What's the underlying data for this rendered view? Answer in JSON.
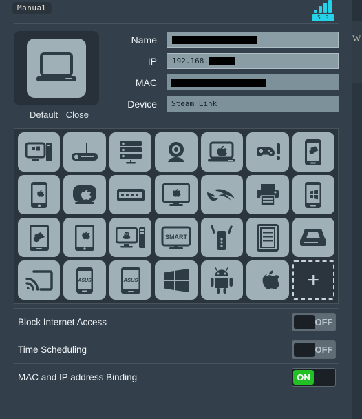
{
  "header": {
    "mode_badge": "Manual",
    "signal": {
      "icon": "signal-bars-icon",
      "bars": 4,
      "band_label": "5 G",
      "color": "#25d2e8"
    }
  },
  "detail": {
    "thumbnail_icon": "laptop-icon",
    "default_link": "Default",
    "close_link": "Close",
    "fields": [
      {
        "label": "Name",
        "value": "",
        "redacted": true,
        "editable": true,
        "redact_width": 124
      },
      {
        "label": "IP",
        "value": "192.168.",
        "redacted": true,
        "editable": true,
        "redact_width": 38
      },
      {
        "label": "MAC",
        "value": "",
        "redacted": true,
        "editable": false,
        "redact_width": 138
      },
      {
        "label": "Device",
        "value": "Steam Link",
        "redacted": false,
        "editable": false,
        "redact_width": 0
      }
    ]
  },
  "icon_grid": {
    "selected_index": null,
    "add_label": "+",
    "icons": [
      {
        "name": "windows-desktop-icon",
        "glyph": "windows-pc"
      },
      {
        "name": "router-icon",
        "glyph": "router"
      },
      {
        "name": "nas-server-icon",
        "glyph": "nas"
      },
      {
        "name": "webcam-icon",
        "glyph": "webcam"
      },
      {
        "name": "macbook-icon",
        "glyph": "macbook"
      },
      {
        "name": "game-console-icon",
        "glyph": "gamepad"
      },
      {
        "name": "smartphone-icon",
        "glyph": "phone-generic"
      },
      {
        "name": "iphone-icon",
        "glyph": "iphone"
      },
      {
        "name": "apple-tv-icon",
        "glyph": "appletv"
      },
      {
        "name": "network-switch-icon",
        "glyph": "switch"
      },
      {
        "name": "imac-icon",
        "glyph": "imac"
      },
      {
        "name": "rog-logo-icon",
        "glyph": "rog"
      },
      {
        "name": "printer-icon",
        "glyph": "printer"
      },
      {
        "name": "windows-phone-icon",
        "glyph": "winphone"
      },
      {
        "name": "android-tablet-icon",
        "glyph": "androidtablet"
      },
      {
        "name": "ipad-icon",
        "glyph": "ipad"
      },
      {
        "name": "linux-pc-icon",
        "glyph": "linuxpc"
      },
      {
        "name": "smart-tv-icon",
        "glyph": "smarttv",
        "text": "SMART"
      },
      {
        "name": "range-extender-icon",
        "glyph": "extender"
      },
      {
        "name": "ereader-icon",
        "glyph": "ereader"
      },
      {
        "name": "scanner-icon",
        "glyph": "scanner"
      },
      {
        "name": "chromecast-icon",
        "glyph": "cast"
      },
      {
        "name": "asus-phone-icon",
        "glyph": "asusphone",
        "text": "ASUS"
      },
      {
        "name": "asus-tablet-icon",
        "glyph": "asustablet",
        "text": "ASUS"
      },
      {
        "name": "windows-logo-icon",
        "glyph": "winlogo"
      },
      {
        "name": "android-robot-icon",
        "glyph": "android"
      },
      {
        "name": "apple-logo-icon",
        "glyph": "apple"
      }
    ]
  },
  "toggles": [
    {
      "label": "Block Internet Access",
      "state": "OFF",
      "on": false
    },
    {
      "label": "Time Scheduling",
      "state": "OFF",
      "on": false
    },
    {
      "label": "MAC and IP address Binding",
      "state": "ON",
      "on": true
    }
  ],
  "colors": {
    "modal_bg": "#333f4a",
    "tile_bg": "#9fb0b6",
    "accent_cyan": "#25d2e8",
    "toggle_on_green": "#22c024"
  }
}
